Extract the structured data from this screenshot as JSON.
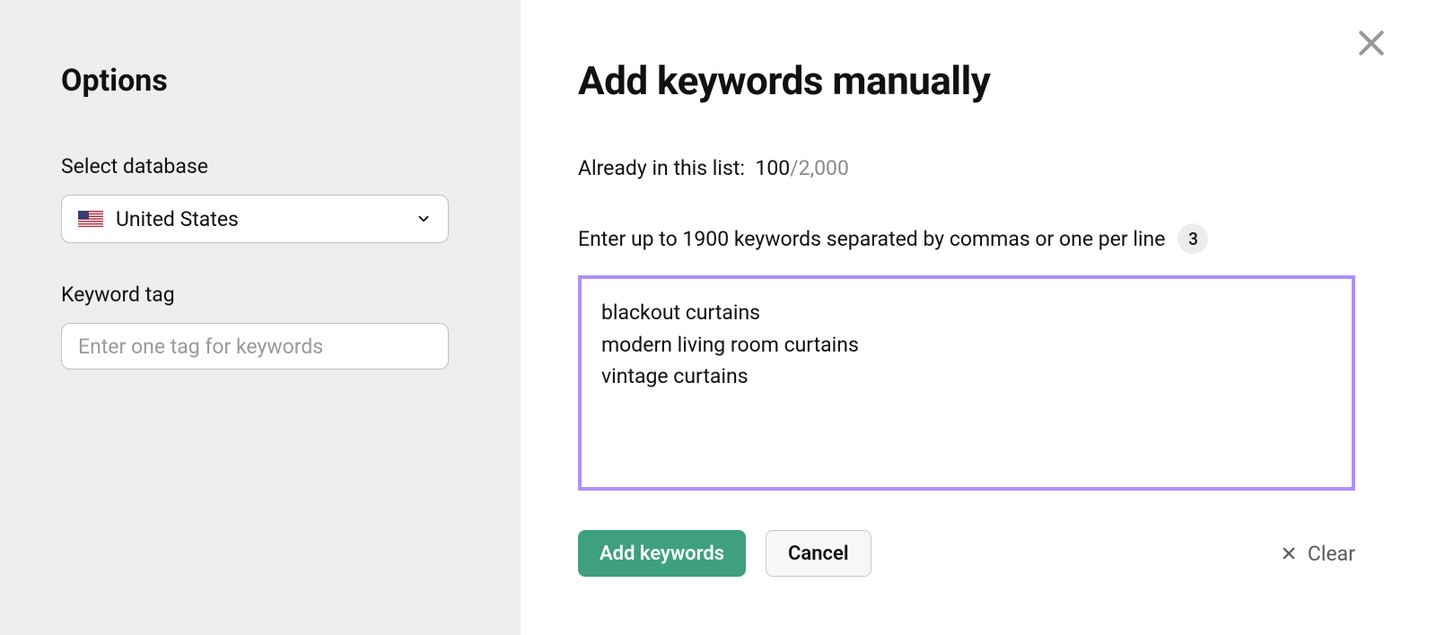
{
  "sidebar": {
    "title": "Options",
    "database_label": "Select database",
    "database_value": "United States",
    "keyword_tag_label": "Keyword tag",
    "keyword_tag_placeholder": "Enter one tag for keywords"
  },
  "main": {
    "title": "Add keywords manually",
    "already_label": "Already in this list:",
    "already_count": "100",
    "already_sep": "/",
    "already_max": "2,000",
    "enter_label": "Enter up to 1900 keywords separated by commas or one per line",
    "entered_count": "3",
    "textarea_value": "blackout curtains\nmodern living room curtains\nvintage curtains",
    "add_button": "Add keywords",
    "cancel_button": "Cancel",
    "clear_button": "Clear"
  }
}
